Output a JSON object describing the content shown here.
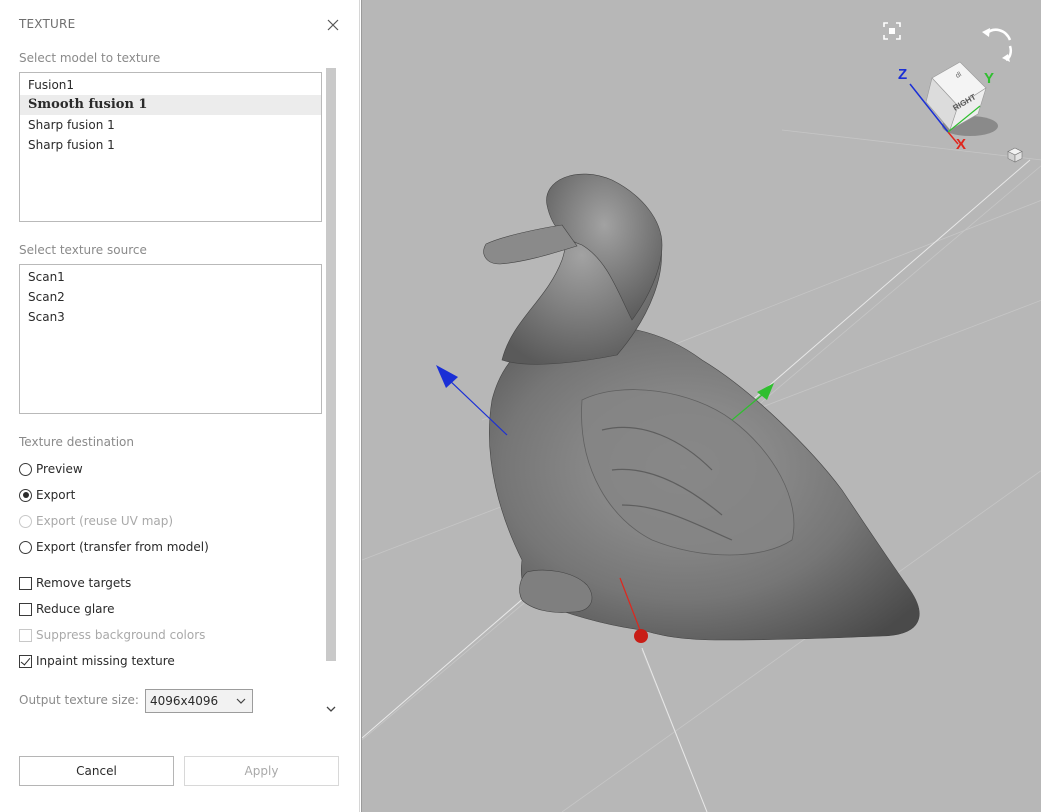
{
  "panel": {
    "title": "TEXTURE",
    "model_section_label": "Select model to texture",
    "models": [
      "Fusion1",
      "Smooth fusion 1",
      "Sharp fusion 1",
      "Sharp fusion 1"
    ],
    "selected_model_index": 1,
    "texture_source_label": "Select texture source",
    "sources": [
      "Scan1",
      "Scan2",
      "Scan3"
    ],
    "destination_label": "Texture destination",
    "destinations": [
      {
        "label": "Preview",
        "checked": false,
        "disabled": false
      },
      {
        "label": "Export",
        "checked": true,
        "disabled": false
      },
      {
        "label": "Export (reuse UV map)",
        "checked": false,
        "disabled": true
      },
      {
        "label": "Export (transfer from model)",
        "checked": false,
        "disabled": false
      }
    ],
    "options": [
      {
        "label": "Remove targets",
        "checked": false,
        "disabled": false
      },
      {
        "label": "Reduce glare",
        "checked": false,
        "disabled": false
      },
      {
        "label": "Suppress background colors",
        "checked": false,
        "disabled": true
      },
      {
        "label": "Inpaint missing texture",
        "checked": true,
        "disabled": false
      }
    ],
    "output_size_label": "Output texture size:",
    "output_size_value": "4096x4096",
    "cancel_label": "Cancel",
    "apply_label": "Apply"
  },
  "viewport": {
    "cube_face_label": "RIGHT",
    "cube_top_label": "dl",
    "axis_z": "Z",
    "axis_y": "Y",
    "axis_x": "X",
    "colors": {
      "background": "#b7b7b7",
      "axis_x": "#e0261d",
      "axis_y": "#2fbf2f",
      "axis_z": "#1a2fd6",
      "model": "#7a7a7a"
    }
  }
}
